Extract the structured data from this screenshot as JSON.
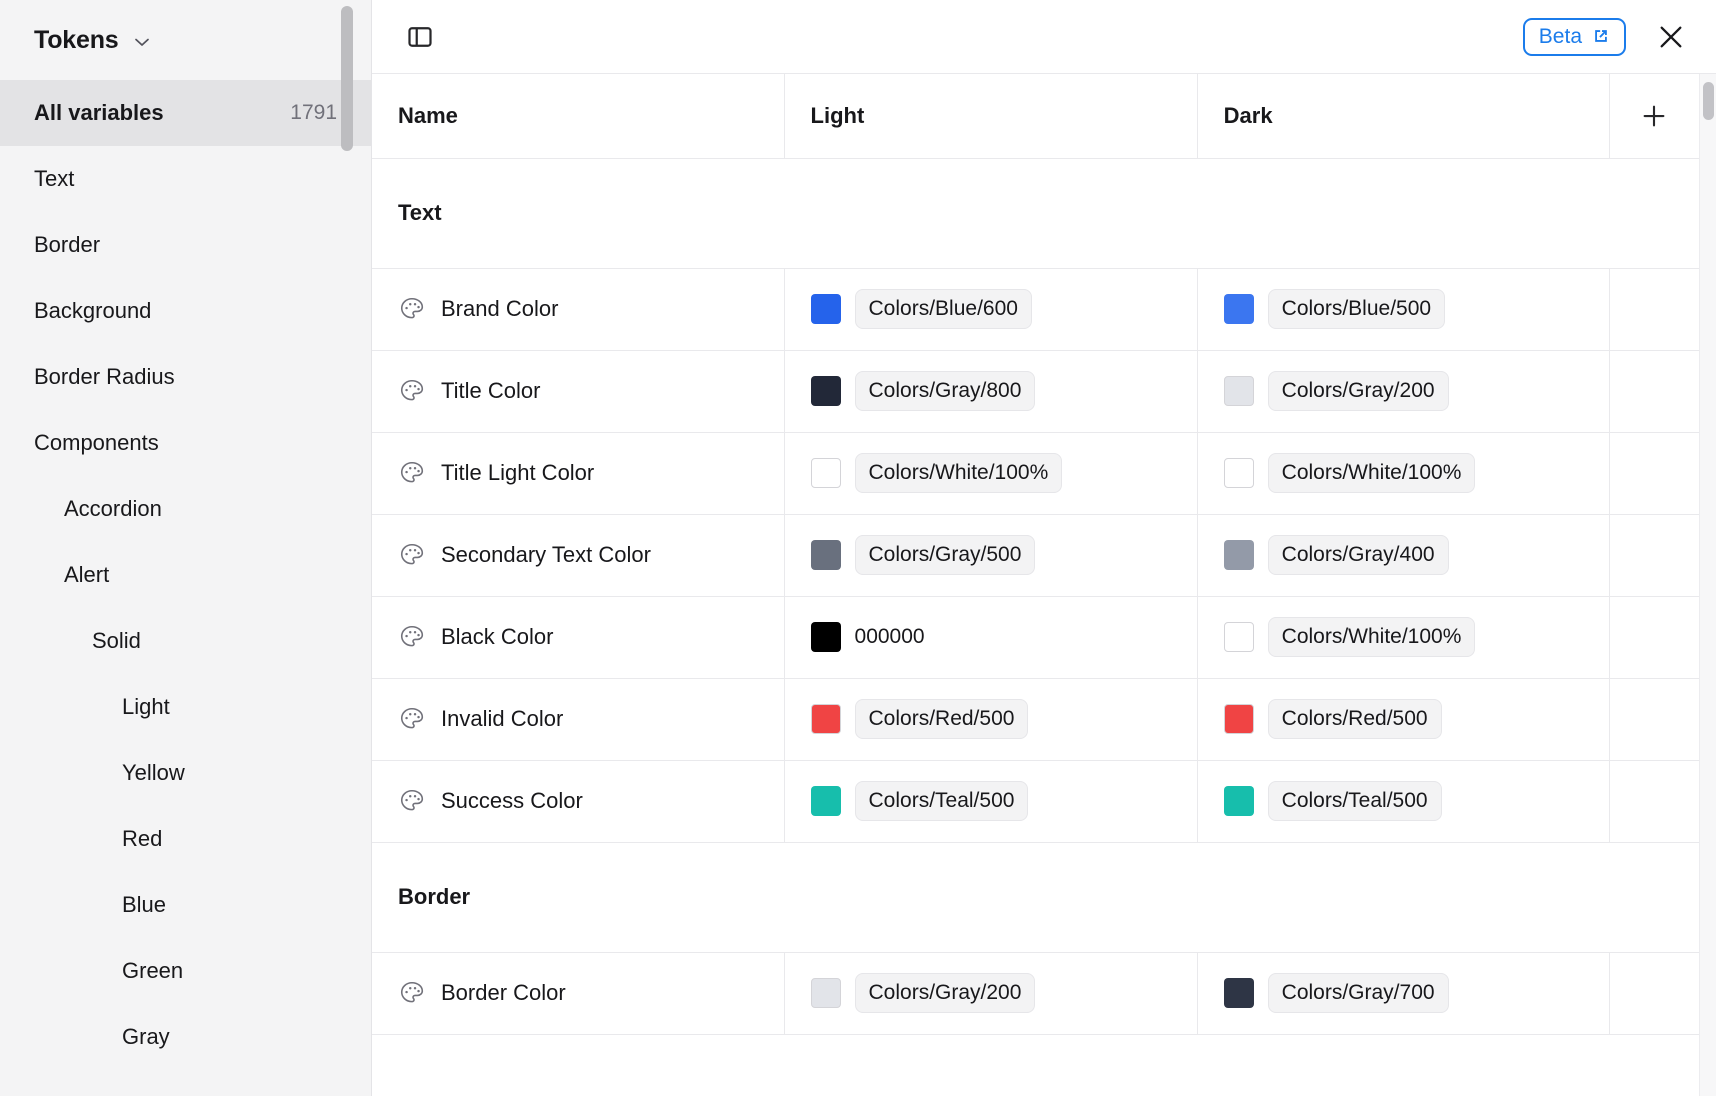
{
  "sidebar": {
    "title": "Tokens",
    "title_chevron_icon": "chevron-down-icon",
    "items": [
      {
        "label": "All variables",
        "count": "1791",
        "depth": 1,
        "active": true
      },
      {
        "label": "Text",
        "count": "",
        "depth": 1,
        "active": false
      },
      {
        "label": "Border",
        "count": "",
        "depth": 1,
        "active": false
      },
      {
        "label": "Background",
        "count": "",
        "depth": 1,
        "active": false
      },
      {
        "label": "Border Radius",
        "count": "",
        "depth": 1,
        "active": false
      },
      {
        "label": "Components",
        "count": "",
        "depth": 1,
        "active": false
      },
      {
        "label": "Accordion",
        "count": "",
        "depth": 2,
        "active": false
      },
      {
        "label": "Alert",
        "count": "",
        "depth": 2,
        "active": false
      },
      {
        "label": "Solid",
        "count": "",
        "depth": 3,
        "active": false
      },
      {
        "label": "Light",
        "count": "",
        "depth": 4,
        "active": false
      },
      {
        "label": "Yellow",
        "count": "",
        "depth": 4,
        "active": false
      },
      {
        "label": "Red",
        "count": "",
        "depth": 4,
        "active": false
      },
      {
        "label": "Blue",
        "count": "",
        "depth": 4,
        "active": false
      },
      {
        "label": "Green",
        "count": "",
        "depth": 4,
        "active": false
      },
      {
        "label": "Gray",
        "count": "",
        "depth": 4,
        "active": false
      }
    ]
  },
  "topbar": {
    "sidebar_toggle_icon": "panel-toggle-icon",
    "beta_label": "Beta",
    "beta_external_icon": "external-link-icon",
    "close_icon": "close-icon"
  },
  "table": {
    "columns": [
      "Name",
      "Light",
      "Dark"
    ],
    "add_column_icon": "plus-icon",
    "row_icon": "palette-icon",
    "sections": [
      {
        "title": "Text",
        "rows": [
          {
            "name": "Brand Color",
            "light": {
              "swatch": "#2563EB",
              "text": "Colors/Blue/600",
              "chip": true
            },
            "dark": {
              "swatch": "#3B76F0",
              "text": "Colors/Blue/500",
              "chip": true
            }
          },
          {
            "name": "Title Color",
            "light": {
              "swatch": "#222838",
              "text": "Colors/Gray/800",
              "chip": true
            },
            "dark": {
              "swatch": "#E2E4E9",
              "text": "Colors/Gray/200",
              "chip": true
            }
          },
          {
            "name": "Title Light Color",
            "light": {
              "swatch": "#FFFFFF",
              "text": "Colors/White/100%",
              "chip": true
            },
            "dark": {
              "swatch": "#FFFFFF",
              "text": "Colors/White/100%",
              "chip": true
            }
          },
          {
            "name": "Secondary Text Color",
            "light": {
              "swatch": "#69707E",
              "text": "Colors/Gray/500",
              "chip": true
            },
            "dark": {
              "swatch": "#939AA8",
              "text": "Colors/Gray/400",
              "chip": true
            }
          },
          {
            "name": "Black Color",
            "light": {
              "swatch": "#000000",
              "text": "000000",
              "chip": false
            },
            "dark": {
              "swatch": "#FFFFFF",
              "text": "Colors/White/100%",
              "chip": true
            }
          },
          {
            "name": "Invalid Color",
            "light": {
              "swatch": "#F04444",
              "text": "Colors/Red/500",
              "chip": true
            },
            "dark": {
              "swatch": "#F04444",
              "text": "Colors/Red/500",
              "chip": true
            }
          },
          {
            "name": "Success Color",
            "light": {
              "swatch": "#17BEAC",
              "text": "Colors/Teal/500",
              "chip": true
            },
            "dark": {
              "swatch": "#17BEAC",
              "text": "Colors/Teal/500",
              "chip": true
            }
          }
        ]
      },
      {
        "title": "Border",
        "rows": [
          {
            "name": "Border Color",
            "light": {
              "swatch": "#E2E4E9",
              "text": "Colors/Gray/200",
              "chip": true
            },
            "dark": {
              "swatch": "#2E3545",
              "text": "Colors/Gray/700",
              "chip": true
            }
          }
        ]
      }
    ]
  },
  "colors": {
    "accent": "#1B7CEB",
    "sidebar_bg": "#F4F4F5",
    "sidebar_active_bg": "#E3E3E5",
    "border": "#E9E9EC",
    "text": "#18181B",
    "muted": "#71717A"
  }
}
